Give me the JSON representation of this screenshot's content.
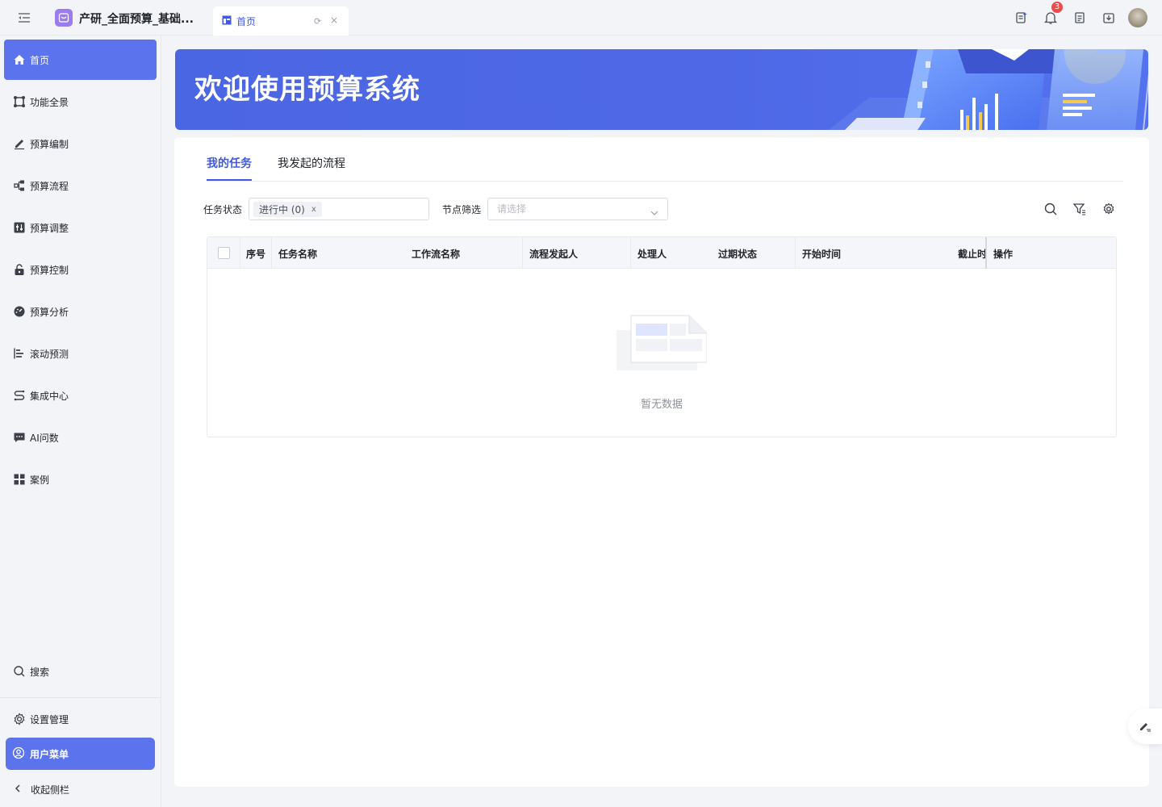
{
  "app": {
    "title": "产研_全面预算_基础...",
    "accent": "#5b73ec",
    "tab_home_label": "首页"
  },
  "topbar": {
    "notification_count": "3",
    "icons": [
      "collapse-menu-icon",
      "app-logo-icon",
      "refresh-icon",
      "close-icon",
      "task-icon",
      "bell-icon",
      "document-icon",
      "download-icon",
      "avatar"
    ]
  },
  "sidebar": {
    "items": [
      {
        "label": "首页",
        "icon": "home-icon",
        "active": true
      },
      {
        "label": "功能全景",
        "icon": "panorama-icon"
      },
      {
        "label": "预算编制",
        "icon": "edit-icon"
      },
      {
        "label": "预算流程",
        "icon": "flow-icon"
      },
      {
        "label": "预算调整",
        "icon": "adjust-icon"
      },
      {
        "label": "预算控制",
        "icon": "lock-icon"
      },
      {
        "label": "预算分析",
        "icon": "gauge-icon"
      },
      {
        "label": "滚动预测",
        "icon": "forecast-icon"
      },
      {
        "label": "集成中心",
        "icon": "integration-icon"
      },
      {
        "label": "AI问数",
        "icon": "chat-icon"
      },
      {
        "label": "案例",
        "icon": "grid-icon"
      }
    ],
    "search_label": "搜索",
    "settings_label": "设置管理",
    "user_menu_label": "用户菜单",
    "collapse_label": "收起侧栏"
  },
  "banner": {
    "title": "欢迎使用预算系统"
  },
  "main": {
    "tabs": [
      {
        "label": "我的任务",
        "active": true
      },
      {
        "label": "我发起的流程",
        "active": false
      }
    ],
    "filters": {
      "status_label": "任务状态",
      "status_chip": "进行中 (0)",
      "status_chip_close": "x",
      "node_label": "节点筛选",
      "node_placeholder": "请选择"
    },
    "table": {
      "columns": [
        "序号",
        "任务名称",
        "工作流名称",
        "流程发起人",
        "处理人",
        "过期状态",
        "开始时间",
        "截止时",
        "操作"
      ],
      "rows": [],
      "empty_text": "暂无数据"
    }
  }
}
